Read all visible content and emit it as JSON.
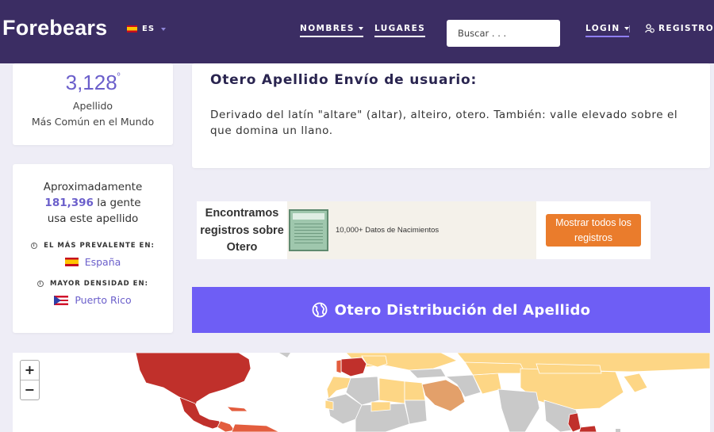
{
  "header": {
    "logo": "Forebears",
    "lang": "ES",
    "nav": {
      "nombres": "NOMBRES",
      "lugares": "LUGARES",
      "login": "LOGIN",
      "registro": "REGISTRO"
    },
    "search_placeholder": "Buscar . . ."
  },
  "rank": {
    "value": "3,128",
    "suffix": "º",
    "label1": "Apellido",
    "label2": "Más Común en el Mundo"
  },
  "origin": {
    "title": "Otero Apellido Envío de usuario:",
    "text": "Derivado del latín \"altare\" (altar), alteiro, otero. También: valle elevado sobre el que domina un llano."
  },
  "people": {
    "line1": "Aproximadamente",
    "count": "181,396",
    "line2_rest": " la gente",
    "line3": "usa este apellido",
    "prevalent_label": "EL MÁS PREVALENTE EN:",
    "prevalent_country": "España",
    "density_label": "MAYOR DENSIDAD EN:",
    "density_country": "Puerto Rico"
  },
  "records": {
    "text": "Encontramos registros sobre Otero",
    "count": "10,000+ Datos de Nacimientos",
    "button": "Mostrar todos los registros"
  },
  "distribution": {
    "title": "Otero Distribución del Apellido"
  },
  "map": {
    "zoom_in": "+",
    "zoom_out": "−",
    "colors": {
      "highest": "#c0302b",
      "high": "#e35d3e",
      "medium": "#e3a06a",
      "low": "#fdd685",
      "none": "#c9c9c9"
    }
  },
  "colors": {
    "header_bg": "#3b2d63",
    "accent": "#6e5ef5",
    "link": "#6b5fcb",
    "cta": "#ea7c2c"
  }
}
